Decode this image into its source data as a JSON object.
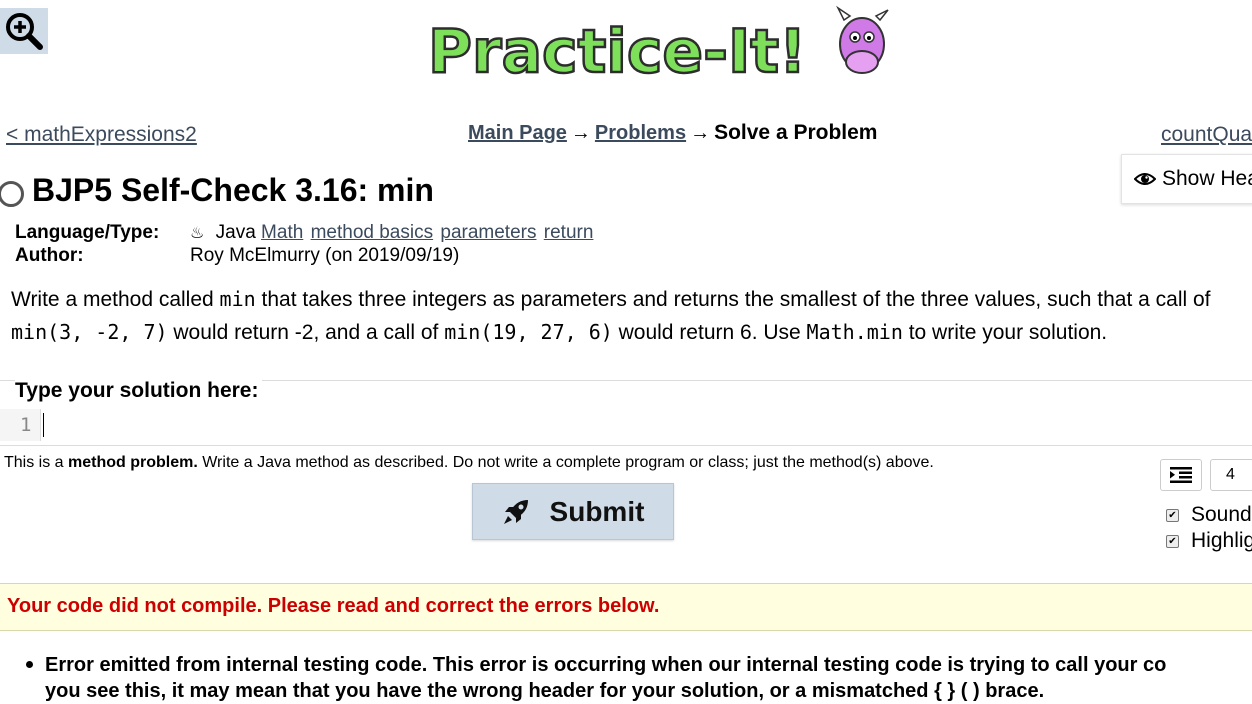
{
  "brand": {
    "logo_text": "Practice-It!"
  },
  "toolbar": {
    "zoom_icon": "zoom-in-icon"
  },
  "nav": {
    "prev": "< mathExpressions2",
    "main_page": "Main Page",
    "arrow": "→",
    "problems": "Problems",
    "current": "Solve a Problem",
    "next": "countQua"
  },
  "show_header": {
    "label": "Show Hea",
    "icon": "eye-icon"
  },
  "problem": {
    "title": "BJP5 Self-Check 3.16: min",
    "language_label": "Language/Type:",
    "language": "Java",
    "tags": [
      "Math",
      "method basics",
      "parameters",
      "return"
    ],
    "author_label": "Author:",
    "author": "Roy McElmurry (on 2019/09/19)",
    "description": {
      "p1": "Write a method called ",
      "c1": "min",
      "p2": " that takes three integers as parameters and returns the smallest of the three values, such that a call of",
      "c2": "min(3, -2, 7)",
      "p3": " would return -2, and a call of ",
      "c3": "min(19, 27, 6)",
      "p4": " would return 6. Use ",
      "c4": "Math.min",
      "p5": " to write your solution."
    }
  },
  "editor": {
    "legend": "Type your solution here:",
    "line_number": "1"
  },
  "method_note": {
    "prefix": "This is a ",
    "bold": "method problem.",
    "rest": " Write a Java method as described. Do not write a complete program or class; just the method(s) above."
  },
  "submit": {
    "label": "Submit",
    "icon": "rocket-icon"
  },
  "options": {
    "tab_size": "4",
    "sound": "Sound",
    "highlight": "Highlig"
  },
  "error": {
    "banner": "Your code did not compile. Please read and correct the errors below.",
    "line1": "Error emitted from internal testing code. This error is occurring when our internal testing code is trying to call your co",
    "line2": "you see this, it may mean that you have the wrong header for your solution, or a mismatched { } ( ) brace."
  },
  "colors": {
    "error_red": "#cc0000",
    "banner_bg": "#ffffe0",
    "submit_bg": "#cfdce8",
    "link": "#3b4a5c"
  }
}
